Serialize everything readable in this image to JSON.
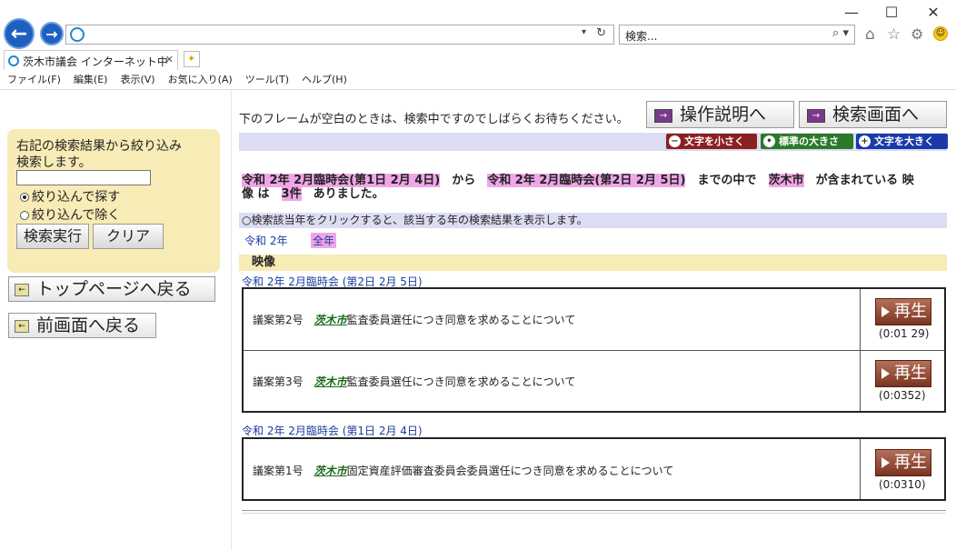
{
  "browser": {
    "search_placeholder": "検索...",
    "tab_title": "茨木市議会 インターネット中継",
    "window_controls": {
      "minimize": "—",
      "maximize": "☐",
      "close": "✕"
    },
    "menu": [
      "ファイル(F)",
      "編集(E)",
      "表示(V)",
      "お気に入り(A)",
      "ツール(T)",
      "ヘルプ(H)"
    ]
  },
  "sidebar": {
    "refine_text_line1": "右記の検索結果から絞り込み",
    "refine_text_line2": "検索します。",
    "refine_input_value": "",
    "radio_include": "絞り込んで探す",
    "radio_exclude": "絞り込んで除く",
    "search_button": "検索実行",
    "clear_button": "クリア",
    "top_page_link": "トップページへ戻る",
    "prev_page_link": "前画面へ戻る"
  },
  "main": {
    "notice": "下のフレームが空白のときは、検索中ですのでしばらくお待ちください。",
    "help_button": "操作説明へ",
    "search_screen_button": "検索画面へ",
    "font_small": "文字を小さく",
    "font_normal": "標準の大きさ",
    "font_large": "文字を大きく",
    "summary": {
      "from": "令和 2年 2月臨時会(第1日 2月 4日)",
      "from_suffix": "から",
      "to": "令和 2年 2月臨時会(第2日 2月 5日)",
      "to_suffix": "までの中で",
      "keyword": "茨木市",
      "keyword_suffix": "が含まれている 映",
      "line2_prefix": "像 は",
      "count": "3件",
      "line2_suffix": "ありました。"
    },
    "year_hint": "○検索該当年をクリックすると、該当する年の検索結果を表示します。",
    "year_links": [
      "令和 2年",
      "全年"
    ],
    "section_title": "映像",
    "groups": [
      {
        "session": "令和 2年 2月臨時会 (第2日 2月 5日)",
        "rows": [
          {
            "prefix": "議案第2号",
            "keyword": "茨木市",
            "rest": "監査委員選任につき同意を求めることについて",
            "play": "再生",
            "duration": "(0:01 29)"
          },
          {
            "prefix": "議案第3号",
            "keyword": "茨木市",
            "rest": "監査委員選任につき同意を求めることについて",
            "play": "再生",
            "duration": "(0:0352)"
          }
        ]
      },
      {
        "session": "令和 2年 2月臨時会 (第1日 2月 4日)",
        "rows": [
          {
            "prefix": "議案第1号",
            "keyword": "茨木市",
            "rest": "固定資産評価審査委員会委員選任につき同意を求めることについて",
            "play": "再生",
            "duration": "(0:0310)"
          }
        ]
      }
    ]
  }
}
